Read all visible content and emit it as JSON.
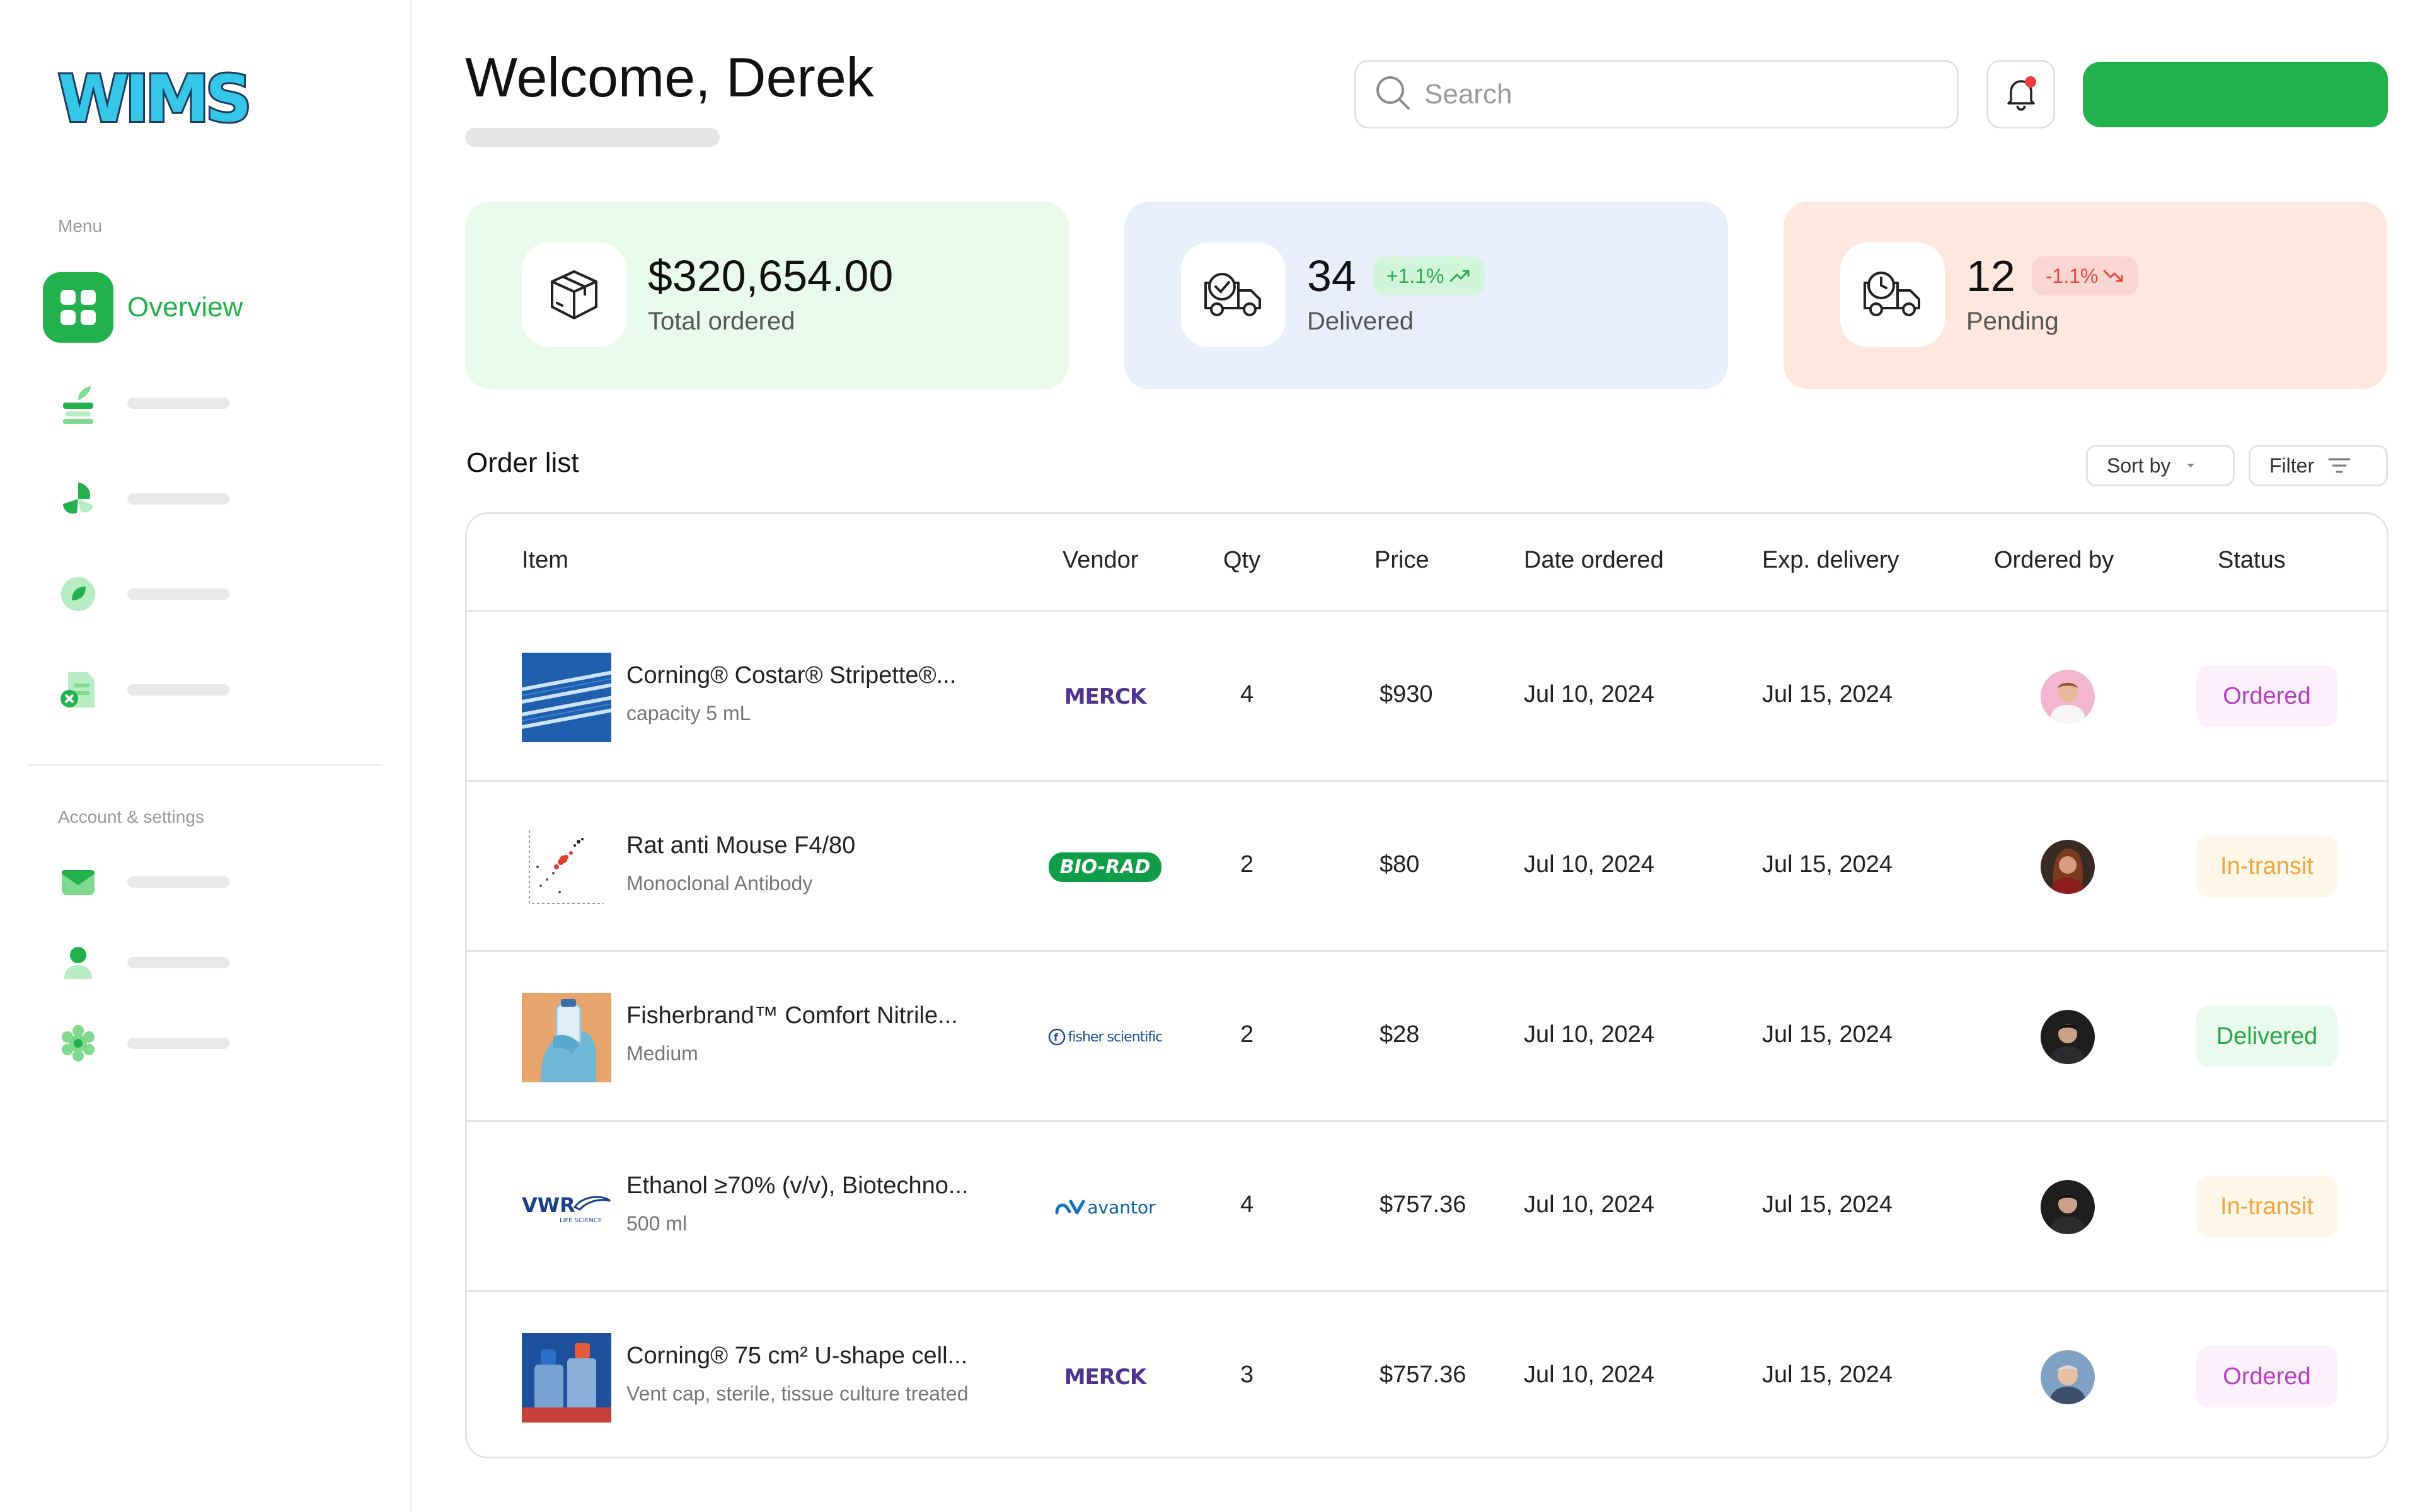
{
  "brand": {
    "logo_text": "WIMS"
  },
  "sidebar": {
    "menu_caption": "Menu",
    "overview_label": "Overview",
    "account_caption": "Account & settings"
  },
  "header": {
    "welcome": "Welcome, Derek",
    "search_placeholder": "Search"
  },
  "stats": [
    {
      "value": "$320,654.00",
      "label": "Total ordered",
      "icon": "package-icon"
    },
    {
      "value": "34",
      "label": "Delivered",
      "badge": "+1.1%",
      "trend": "up",
      "icon": "truck-check-icon"
    },
    {
      "value": "12",
      "label": "Pending",
      "badge": "-1.1%",
      "trend": "down",
      "icon": "truck-clock-icon"
    }
  ],
  "orders": {
    "title": "Order list",
    "sort_label": "Sort by",
    "filter_label": "Filter",
    "columns": [
      "Item",
      "Vendor",
      "Qty",
      "Price",
      "Date ordered",
      "Exp. delivery",
      "Ordered by",
      "Status"
    ],
    "rows": [
      {
        "name": "Corning® Costar® Stripette®...",
        "sub": "capacity 5 mL",
        "vendor": "Merck",
        "qty": "4",
        "price": "$930",
        "date": "Jul 10, 2024",
        "delivery": "Jul 15, 2024",
        "status": "Ordered"
      },
      {
        "name": "Rat anti Mouse F4/80",
        "sub": "Monoclonal Antibody",
        "vendor": "Bio-Rad",
        "qty": "2",
        "price": "$80",
        "date": "Jul 10, 2024",
        "delivery": "Jul 15, 2024",
        "status": "In-transit"
      },
      {
        "name": "Fisherbrand™ Comfort Nitrile...",
        "sub": "Medium",
        "vendor": "Fisher Scientific",
        "qty": "2",
        "price": "$28",
        "date": "Jul 10, 2024",
        "delivery": "Jul 15, 2024",
        "status": "Delivered"
      },
      {
        "name": "Ethanol ≥70% (v/v), Biotechno...",
        "sub": "500 ml",
        "vendor": "Avantor",
        "qty": "4",
        "price": "$757.36",
        "date": "Jul 10, 2024",
        "delivery": "Jul 15, 2024",
        "status": "In-transit"
      },
      {
        "name": "Corning® 75 cm² U-shape cell...",
        "sub": "Vent cap, sterile, tissue culture treated",
        "vendor": "Merck",
        "qty": "3",
        "price": "$757.36",
        "date": "Jul 10, 2024",
        "delivery": "Jul 15, 2024",
        "status": "Ordered"
      }
    ]
  },
  "vendor_logos": {
    "merck": "MERCK",
    "biorad": "BIO-RAD",
    "fisher": "fisher scientific",
    "avantor": "avantor",
    "vwr": "VWR",
    "vwr_sub": "LIFE SCIENCE"
  },
  "colors": {
    "accent": "#22b14c",
    "ordered": "#b53fc4",
    "transit": "#f0a43a",
    "delivered": "#27a844"
  }
}
